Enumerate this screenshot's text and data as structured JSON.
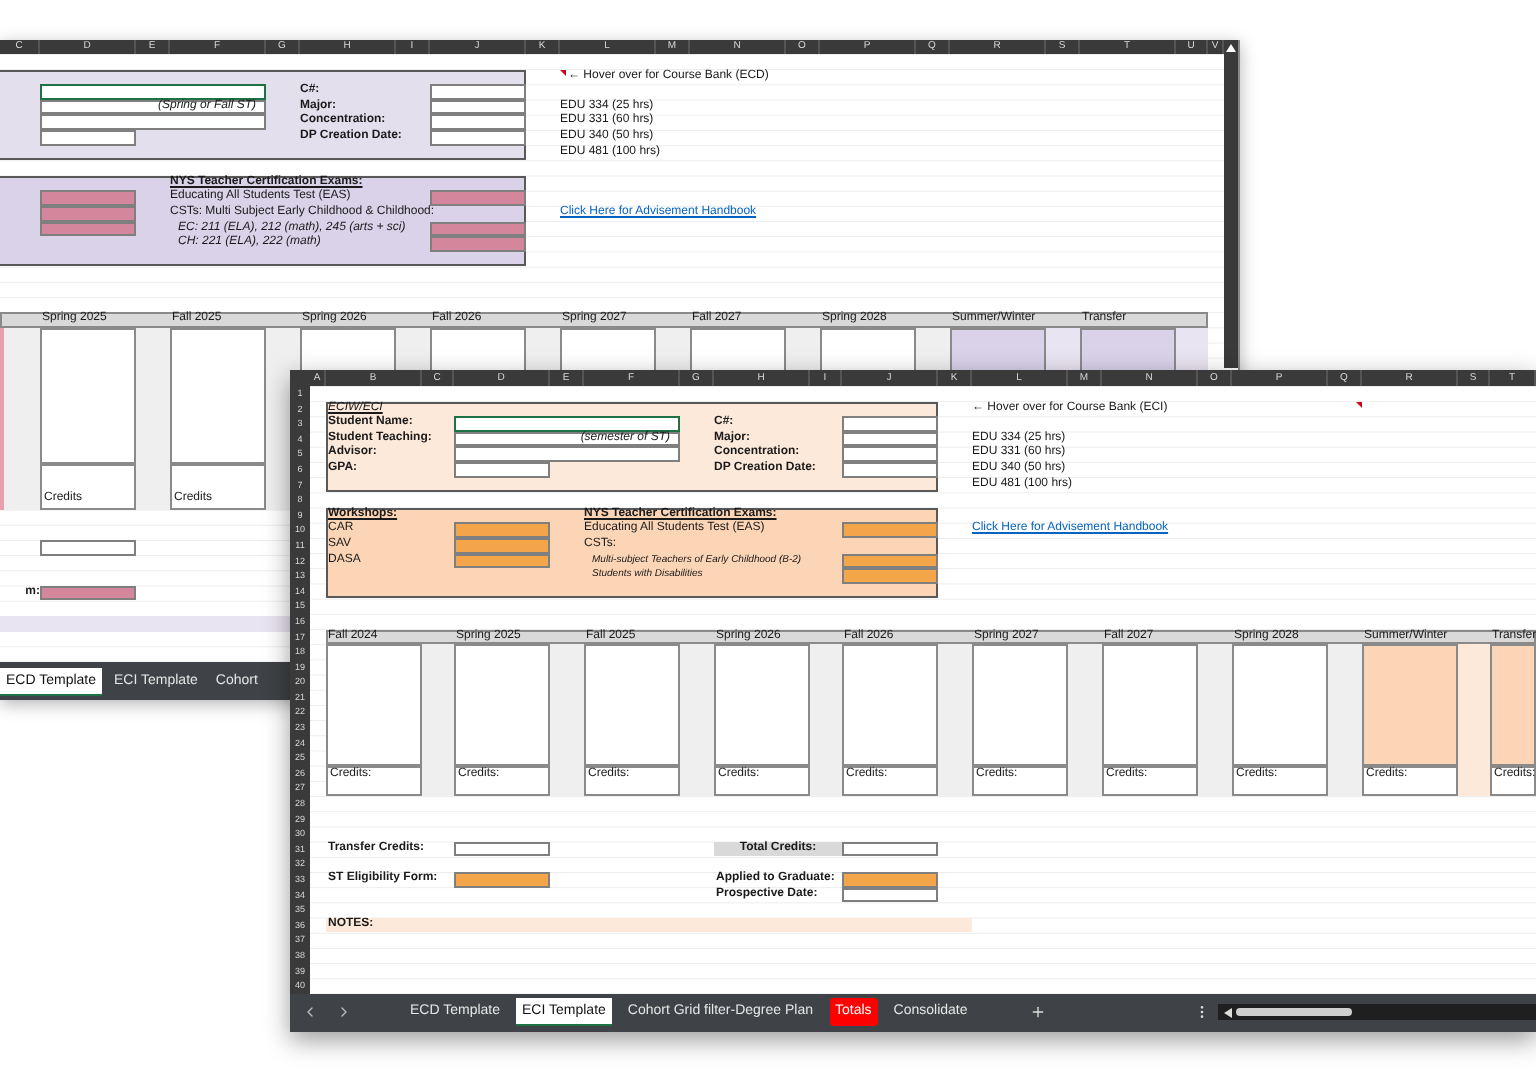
{
  "back_window": {
    "column_headers": [
      "C",
      "D",
      "E",
      "F",
      "G",
      "H",
      "I",
      "J",
      "K",
      "L",
      "M",
      "N",
      "O",
      "P",
      "Q",
      "R",
      "S",
      "T",
      "U",
      "V"
    ],
    "student_fields": [
      {
        "selected": true,
        "short": false
      },
      {
        "selected": false,
        "short": false,
        "note": "(Spring or Fall ST)"
      },
      {
        "selected": false,
        "short": false
      },
      {
        "selected": false,
        "short": true
      }
    ],
    "program_labels": [
      "C#:",
      "Major:",
      "Concentration:",
      "DP Creation Date:"
    ],
    "exams": {
      "title": "NYS Teacher Certification Exams:",
      "lines": [
        {
          "text": "Educating All Students Test (EAS)",
          "italic": false,
          "field": true
        },
        {
          "text": "CSTs: Multi Subject Early Childhood & Childhood:",
          "italic": false,
          "field": false
        },
        {
          "text": "EC: 211 (ELA), 212 (math), 245 (arts + sci)",
          "italic": true,
          "field": true
        },
        {
          "text": "CH: 221 (ELA), 222 (math)",
          "italic": true,
          "field": true
        }
      ]
    },
    "course_bank_hint": "← Hover over for Course Bank (ECD)",
    "courses": [
      "EDU 334 (25 hrs)",
      "EDU 331 (60 hrs)",
      "EDU 340 (50 hrs)",
      "EDU 481 (100 hrs)"
    ],
    "handbook_link": "Click Here for Advisement Handbook",
    "schedule": [
      {
        "term": "Spring 2025",
        "kind": "term",
        "credits": "Credits"
      },
      {
        "term": "Fall 2025",
        "kind": "term",
        "credits": "Credits"
      },
      {
        "term": "Spring 2026",
        "kind": "term"
      },
      {
        "term": "Fall 2026",
        "kind": "term"
      },
      {
        "term": "Spring 2027",
        "kind": "term"
      },
      {
        "term": "Fall 2027",
        "kind": "term"
      },
      {
        "term": "Spring 2028",
        "kind": "term"
      },
      {
        "term": "Summer/Winter",
        "kind": "extra"
      },
      {
        "term": "Transfer",
        "kind": "extra"
      }
    ],
    "summary": [
      {
        "kind": "input"
      },
      {
        "label": "m:",
        "kind": "required"
      }
    ],
    "sheet_tabs": [
      {
        "label": "ECD Template",
        "selected": true
      },
      {
        "label": "ECI Template",
        "selected": false
      },
      {
        "label": "Cohort",
        "selected": false
      }
    ]
  },
  "front_window": {
    "column_headers": [
      "A",
      "B",
      "C",
      "D",
      "E",
      "F",
      "G",
      "H",
      "I",
      "J",
      "K",
      "L",
      "M",
      "N",
      "O",
      "P",
      "Q",
      "R",
      "S",
      "T"
    ],
    "row_numbers": [
      "1",
      "2",
      "3",
      "4",
      "5",
      "6",
      "7",
      "8",
      "9",
      "10",
      "11",
      "12",
      "13",
      "14",
      "15",
      "16",
      "17",
      "18",
      "19",
      "20",
      "21",
      "22",
      "23",
      "24",
      "25",
      "26",
      "27",
      "28",
      "29",
      "30",
      "31",
      "32",
      "33",
      "34",
      "35",
      "36",
      "37",
      "38",
      "39",
      "40"
    ],
    "form_title": "ECIW/ECI",
    "student_fields": [
      {
        "label": "Student Name:",
        "selected": true,
        "short": false
      },
      {
        "label": "Student Teaching:",
        "selected": false,
        "short": false,
        "note": "(semester of ST)"
      },
      {
        "label": "Advisor:",
        "selected": false,
        "short": false
      },
      {
        "label": "GPA:",
        "selected": false,
        "short": true
      }
    ],
    "program_labels": [
      "C#:",
      "Major:",
      "Concentration:",
      "DP Creation Date:"
    ],
    "workshops": {
      "title": "Workshops:",
      "items": [
        "CAR",
        "SAV",
        "DASA"
      ]
    },
    "exams": {
      "title": "NYS Teacher Certification Exams:",
      "lines": [
        {
          "text": "Educating All Students Test (EAS)",
          "italic": false,
          "field": true
        },
        {
          "text": "CSTs:",
          "italic": false,
          "field": false
        },
        {
          "text": "Multi-subject Teachers of Early Childhood (B-2)",
          "italic": true,
          "field": true
        },
        {
          "text": "Students with Disabilities",
          "italic": true,
          "field": true
        }
      ]
    },
    "course_bank_hint": "← Hover over for Course Bank (ECI)",
    "courses": [
      "EDU 334 (25 hrs)",
      "EDU 331 (60 hrs)",
      "EDU 340 (50 hrs)",
      "EDU 481 (100 hrs)"
    ],
    "handbook_link": "Click Here for Advisement Handbook",
    "schedule": [
      {
        "term": "Fall 2024",
        "kind": "term",
        "credits": "Credits:"
      },
      {
        "term": "Spring 2025",
        "kind": "term",
        "credits": "Credits:"
      },
      {
        "term": "Fall 2025",
        "kind": "term",
        "credits": "Credits:"
      },
      {
        "term": "Spring 2026",
        "kind": "term",
        "credits": "Credits:"
      },
      {
        "term": "Fall 2026",
        "kind": "term",
        "credits": "Credits:"
      },
      {
        "term": "Spring 2027",
        "kind": "term",
        "credits": "Credits:"
      },
      {
        "term": "Fall 2027",
        "kind": "term",
        "credits": "Credits:"
      },
      {
        "term": "Spring 2028",
        "kind": "term",
        "credits": "Credits:"
      },
      {
        "term": "Summer/Winter",
        "kind": "extra",
        "credits": "Credits:"
      },
      {
        "term": "Transfer",
        "kind": "extra",
        "credits": "Credits:"
      }
    ],
    "summary": [
      {
        "label": "Transfer Credits:",
        "kind": "input"
      },
      {
        "label": "Total Credits:",
        "kind": "total"
      },
      {
        "label": "ST Eligibility Form:",
        "kind": "required"
      },
      {
        "label": "Applied to Graduate:",
        "kind": "required"
      },
      {
        "label": "Prospective Date:",
        "kind": "input"
      }
    ],
    "notes_label": "NOTES:",
    "sheet_tabs": [
      {
        "label": "ECD Template",
        "selected": false
      },
      {
        "label": "ECI Template",
        "selected": true
      },
      {
        "label": "Cohort Grid filter-Degree Plan",
        "selected": false
      },
      {
        "label": "Totals",
        "selected": false,
        "color": "#ff0000"
      },
      {
        "label": "Consolidate",
        "selected": false
      }
    ]
  }
}
